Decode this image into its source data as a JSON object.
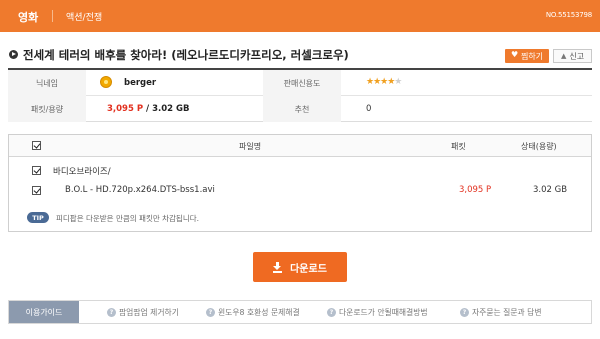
{
  "topbar": {
    "category": "영화",
    "subcategory": "액션/전쟁",
    "number": "NO.55153798"
  },
  "title": {
    "text": "전세계 테러의 배후를 찾아라! (레오나르도디카프리오, 러셀크로우)",
    "favorite_label": "찜하기",
    "report_label": "신고"
  },
  "info": {
    "nickname_label": "닉네임",
    "nickname": "berger",
    "trust_label": "판매신용도",
    "trust_stars": 4,
    "trust_max": 5,
    "packet_label": "패킷/용량",
    "packet": "3,095 P",
    "separator": " / ",
    "size": "3.02 GB",
    "recommend_label": "추천",
    "recommend": "0"
  },
  "files": {
    "columns": {
      "name": "파일명",
      "packet": "패킷",
      "status": "상태(용량)"
    },
    "folder": "바디오브라이즈/",
    "items": [
      {
        "name": "B.O.L - HD.720p.x264.DTS-bss1.avi",
        "packet": "3,095 P",
        "size": "3.02 GB",
        "checked": true
      }
    ],
    "tip_badge": "TIP",
    "tip_text": "피디팝은 다운받은 만큼의 패킷만 차감됩니다."
  },
  "download": {
    "label": "다운로드"
  },
  "guide": {
    "label": "이용가이드",
    "items": [
      "팝업팝업 제거하기",
      "윈도우8 호환성 문제해결",
      "다운로드가 안될때해결방법",
      "자주묻는 질문과 답변"
    ]
  },
  "colors": {
    "accent": "#ef7a2d",
    "price": "#e2301f",
    "guide": "#8c9aae"
  },
  "icons": [
    "play-bullet-icon",
    "heart-icon",
    "warning-icon",
    "user-level-icon",
    "star-icon",
    "checkbox-icon",
    "download-icon",
    "question-icon"
  ]
}
